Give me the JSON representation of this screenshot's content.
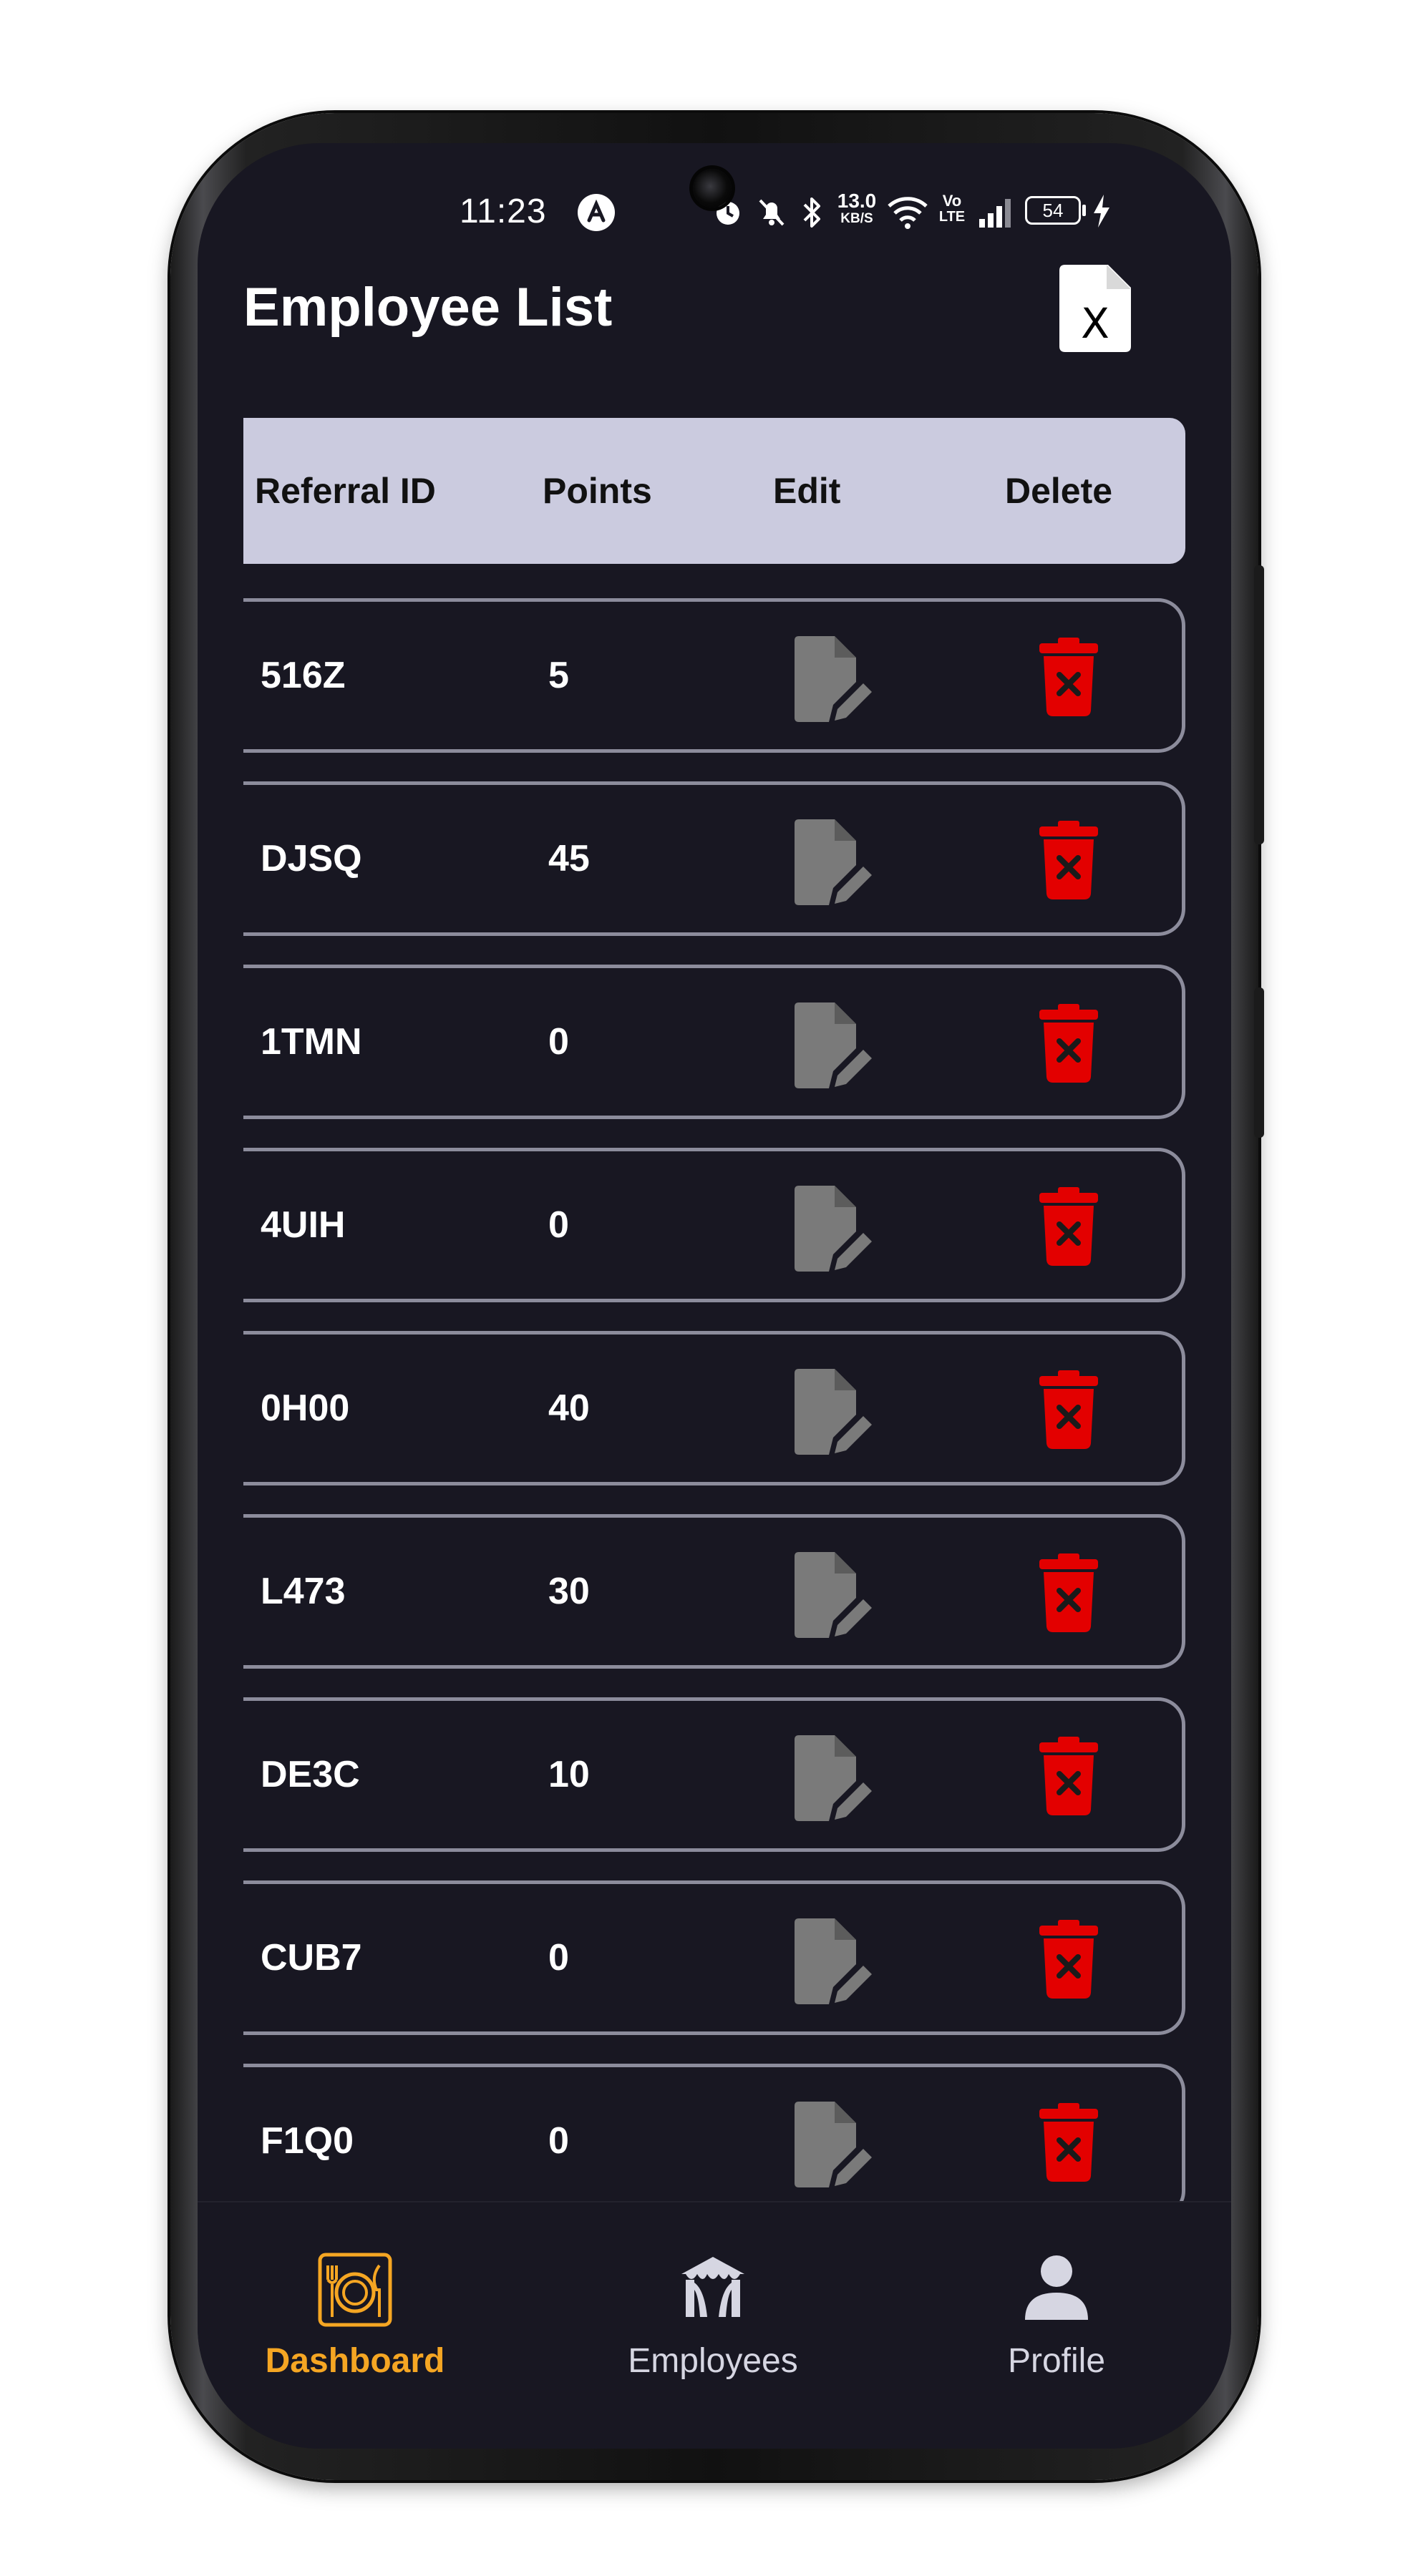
{
  "status_bar": {
    "time": "11:23",
    "network_speed_value": "13.0",
    "network_speed_unit": "KB/S",
    "volte_label": "Vo",
    "lte_label": "LTE",
    "battery": "54"
  },
  "header": {
    "title": "Employee List",
    "export_icon": "excel-file-icon"
  },
  "table": {
    "columns": [
      "Referral ID",
      "Points",
      "Edit",
      "Delete"
    ],
    "rows": [
      {
        "referral_id": "516Z",
        "points": "5"
      },
      {
        "referral_id": "DJSQ",
        "points": "45"
      },
      {
        "referral_id": "1TMN",
        "points": "0"
      },
      {
        "referral_id": "4UIH",
        "points": "0"
      },
      {
        "referral_id": "0H00",
        "points": "40"
      },
      {
        "referral_id": "L473",
        "points": "30"
      },
      {
        "referral_id": "DE3C",
        "points": "10"
      },
      {
        "referral_id": "CUB7",
        "points": "0"
      },
      {
        "referral_id": "F1Q0",
        "points": "0"
      }
    ],
    "edit_icon": "edit-document-icon",
    "delete_icon": "delete-trash-icon"
  },
  "bottom_nav": {
    "items": [
      {
        "label": "Dashboard",
        "icon": "dashboard-plate-icon",
        "active": true
      },
      {
        "label": "Employees",
        "icon": "employees-tent-icon",
        "active": false
      },
      {
        "label": "Profile",
        "icon": "profile-person-icon",
        "active": false
      }
    ]
  },
  "colors": {
    "background": "#181722",
    "header_row": "#cbcbdf",
    "row_border": "#8c8c9c",
    "delete_red": "#e30000",
    "edit_gray": "#7a7a7a",
    "active_nav": "#f5a623",
    "inactive_nav": "#d6d6e2"
  }
}
